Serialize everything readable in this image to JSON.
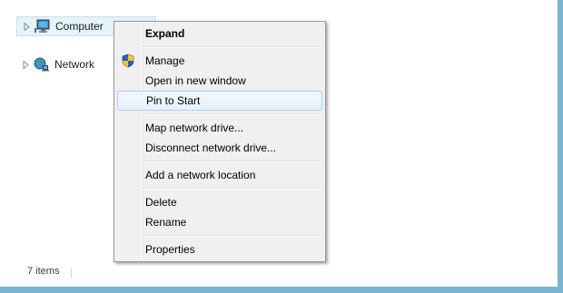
{
  "navigation": {
    "items": [
      {
        "label": "Computer",
        "icon": "computer-icon",
        "selected": true
      },
      {
        "label": "Network",
        "icon": "network-icon",
        "selected": false
      }
    ]
  },
  "context_menu": {
    "items": [
      {
        "label": "Expand",
        "bold": true
      },
      {
        "label": "Manage",
        "icon": "shield-icon"
      },
      {
        "label": "Open in new window"
      },
      {
        "label": "Pin to Start",
        "hovered": true
      },
      {
        "label": "Map network drive..."
      },
      {
        "label": "Disconnect network drive..."
      },
      {
        "label": "Add a network location"
      },
      {
        "label": "Delete"
      },
      {
        "label": "Rename"
      },
      {
        "label": "Properties"
      }
    ]
  },
  "status_bar": {
    "item_count": "7 items"
  },
  "colors": {
    "frame_border": "#7ab5cf",
    "selection_bg": "#e5f3fb",
    "menu_bg": "#f0f0f0",
    "menu_hover_border": "#aecff7"
  }
}
